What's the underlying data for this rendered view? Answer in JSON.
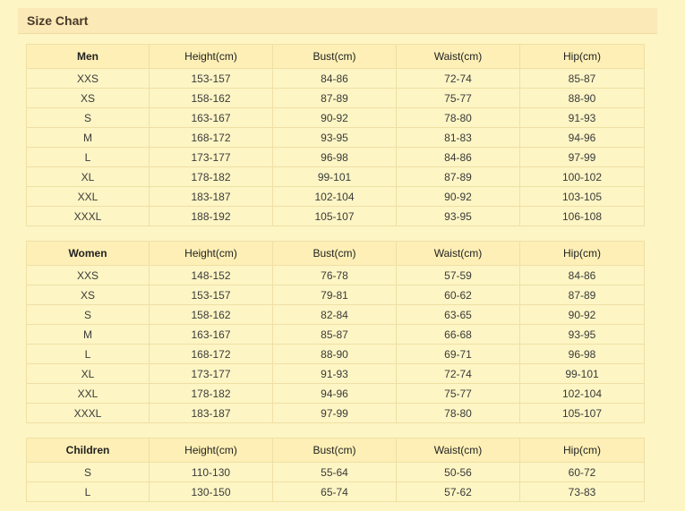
{
  "title": "Size Chart",
  "columns": [
    "Height(cm)",
    "Bust(cm)",
    "Waist(cm)",
    "Hip(cm)"
  ],
  "tables": [
    {
      "group": "Men",
      "rows": [
        [
          "XXS",
          "153-157",
          "84-86",
          "72-74",
          "85-87"
        ],
        [
          "XS",
          "158-162",
          "87-89",
          "75-77",
          "88-90"
        ],
        [
          "S",
          "163-167",
          "90-92",
          "78-80",
          "91-93"
        ],
        [
          "M",
          "168-172",
          "93-95",
          "81-83",
          "94-96"
        ],
        [
          "L",
          "173-177",
          "96-98",
          "84-86",
          "97-99"
        ],
        [
          "XL",
          "178-182",
          "99-101",
          "87-89",
          "100-102"
        ],
        [
          "XXL",
          "183-187",
          "102-104",
          "90-92",
          "103-105"
        ],
        [
          "XXXL",
          "188-192",
          "105-107",
          "93-95",
          "106-108"
        ]
      ]
    },
    {
      "group": "Women",
      "rows": [
        [
          "XXS",
          "148-152",
          "76-78",
          "57-59",
          "84-86"
        ],
        [
          "XS",
          "153-157",
          "79-81",
          "60-62",
          "87-89"
        ],
        [
          "S",
          "158-162",
          "82-84",
          "63-65",
          "90-92"
        ],
        [
          "M",
          "163-167",
          "85-87",
          "66-68",
          "93-95"
        ],
        [
          "L",
          "168-172",
          "88-90",
          "69-71",
          "96-98"
        ],
        [
          "XL",
          "173-177",
          "91-93",
          "72-74",
          "99-101"
        ],
        [
          "XXL",
          "178-182",
          "94-96",
          "75-77",
          "102-104"
        ],
        [
          "XXXL",
          "183-187",
          "97-99",
          "78-80",
          "105-107"
        ]
      ]
    },
    {
      "group": "Children",
      "rows": [
        [
          "S",
          "110-130",
          "55-64",
          "50-56",
          "60-72"
        ],
        [
          "L",
          "130-150",
          "65-74",
          "57-62",
          "73-83"
        ]
      ]
    }
  ]
}
